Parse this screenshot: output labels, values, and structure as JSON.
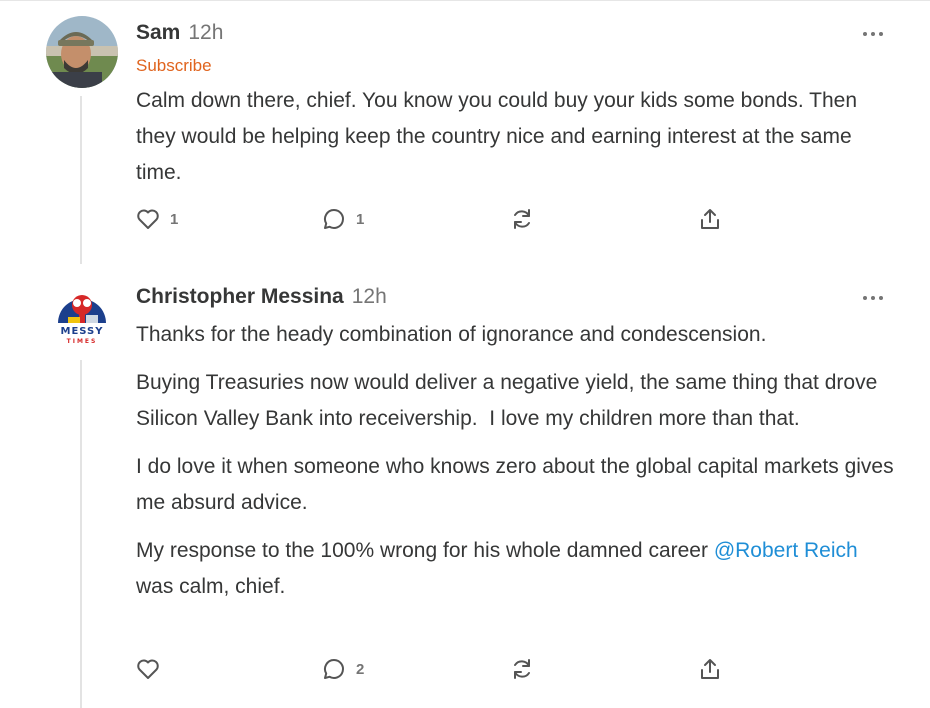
{
  "comments": [
    {
      "author": "Sam",
      "time": "12h",
      "subscribe_label": "Subscribe",
      "paragraphs": [
        "Calm down there, chief. You know you could buy your kids some bonds. Then they would be helping keep the country nice and earning interest at the same time."
      ],
      "likes": "1",
      "replies": "1"
    },
    {
      "author": "Christopher Messina",
      "time": "12h",
      "avatar_text_line1": "MESSY",
      "avatar_text_line2": "TIMES",
      "paragraphs": [
        "Thanks for the heady combination of ignorance and condescension.",
        "Buying Treasuries now would deliver a negative yield, the same thing that drove Silicon Valley Bank into receivership.  I love my children more than that.",
        "I do love it when someone who knows zero about the global capital markets gives me absurd advice."
      ],
      "last_paragraph": {
        "before": "My response to the 100% wrong for his whole damned career ",
        "mention": "@Robert Reich",
        "after": " was calm, chief."
      },
      "likes": "",
      "replies": "2"
    }
  ],
  "icons": {
    "more": "more-horizontal-icon",
    "like": "heart-icon",
    "reply": "comment-bubble-icon",
    "restack": "restack-icon",
    "share": "share-icon"
  },
  "colors": {
    "subscribe": "#e0641e",
    "mention": "#1f8ed6",
    "text": "#363737",
    "muted": "#757575"
  }
}
